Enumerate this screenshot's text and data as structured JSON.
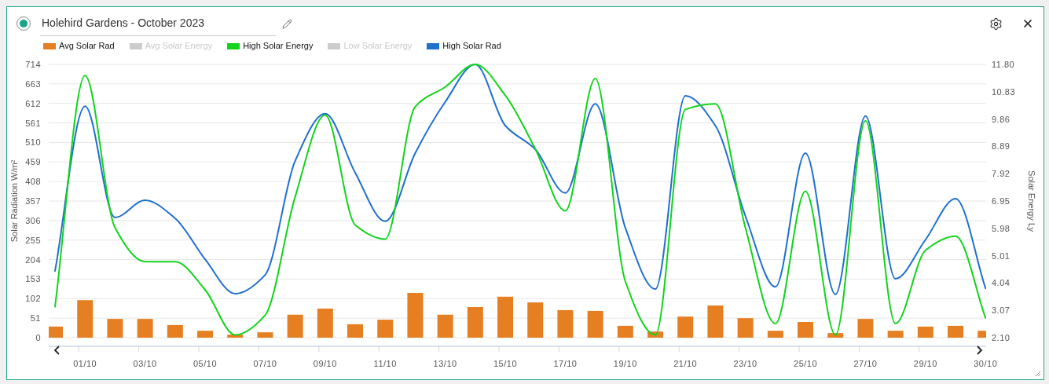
{
  "header": {
    "title": "Holehird Gardens - October 2023",
    "selected": true
  },
  "legend": [
    {
      "visible": true
    },
    {
      "label": "Avg Solar Energy",
      "visible": false
    },
    {
      "visible": true
    },
    {
      "label": "Low Solar Energy",
      "visible": false
    },
    {
      "visible": true
    }
  ],
  "chart": {
    "chart_data": {
      "type": "bar",
      "grid": true,
      "ylabel": "Solar Radiation W/m²",
      "categories": [
        null,
        "01/10",
        null,
        "03/10",
        null,
        "05/10",
        null,
        "07/10",
        null,
        "09/10",
        null,
        "11/10",
        null,
        "13/10",
        null,
        "15/10",
        null,
        "17/10",
        null,
        "19/10",
        null,
        "21/10",
        null,
        "23/10",
        null,
        "25/10",
        null,
        "27/10",
        null,
        "29/10",
        null,
        "30/10"
      ],
      "ylim": [
        0,
        714
      ],
      "yticks": [
        0,
        51,
        102,
        153,
        204,
        255,
        306,
        357,
        408,
        459,
        510,
        561,
        612,
        663,
        714
      ],
      "series": [
        {
          "name": "Avg Solar Rad",
          "color": "#e67e22",
          "values": [
            29,
            98,
            49,
            49,
            33,
            18,
            8,
            14,
            60,
            76,
            35,
            47,
            117,
            60,
            80,
            107,
            92,
            72,
            70,
            31,
            16,
            55,
            84,
            51,
            18,
            41,
            12,
            49,
            18,
            29,
            31,
            18
          ]
        },
        {
          "name": "High Solar Rad",
          "type": "line",
          "color": "#1f6fcc",
          "values": [
            174,
            605,
            314,
            359,
            312,
            205,
            115,
            164,
            462,
            585,
            431,
            304,
            482,
            616,
            714,
            554,
            492,
            378,
            611,
            287,
            127,
            632,
            554,
            318,
            133,
            482,
            113,
            579,
            154,
            256,
            363,
            129
          ]
        }
      ]
    }
  },
  "overlay_chart": {
    "chart_data": {
      "type": "line",
      "ylabel": "Solar Energy Ly",
      "ylim": [
        2.1,
        11.8
      ],
      "yticks": [
        {
          "value": 2.1,
          "label": "2.10"
        },
        {
          "value": 3.07,
          "label": "3.07"
        },
        {
          "value": 4.04,
          "label": "4.04"
        },
        {
          "value": 5.01,
          "label": "5.01"
        },
        {
          "value": 5.98,
          "label": "5.98"
        },
        {
          "value": 6.95,
          "label": "6.95"
        },
        {
          "value": 7.92,
          "label": "7.92"
        },
        {
          "value": 8.89,
          "label": "8.89"
        },
        {
          "value": 9.86,
          "label": "9.86"
        },
        {
          "value": 10.83,
          "label": "10.83"
        },
        {
          "value": 11.8,
          "label": "11.80"
        }
      ],
      "series": [
        {
          "name": "High Solar Energy",
          "color": "#11d41c",
          "values": [
            3.2,
            11.4,
            6.0,
            4.8,
            4.8,
            3.8,
            2.2,
            2.9,
            7.1,
            10.0,
            6.1,
            5.6,
            10.3,
            11.0,
            11.8,
            10.7,
            8.8,
            6.6,
            11.3,
            4.1,
            2.2,
            10.2,
            10.4,
            6.0,
            2.6,
            7.3,
            2.2,
            9.8,
            2.6,
            5.2,
            5.7,
            2.8
          ]
        }
      ]
    }
  }
}
